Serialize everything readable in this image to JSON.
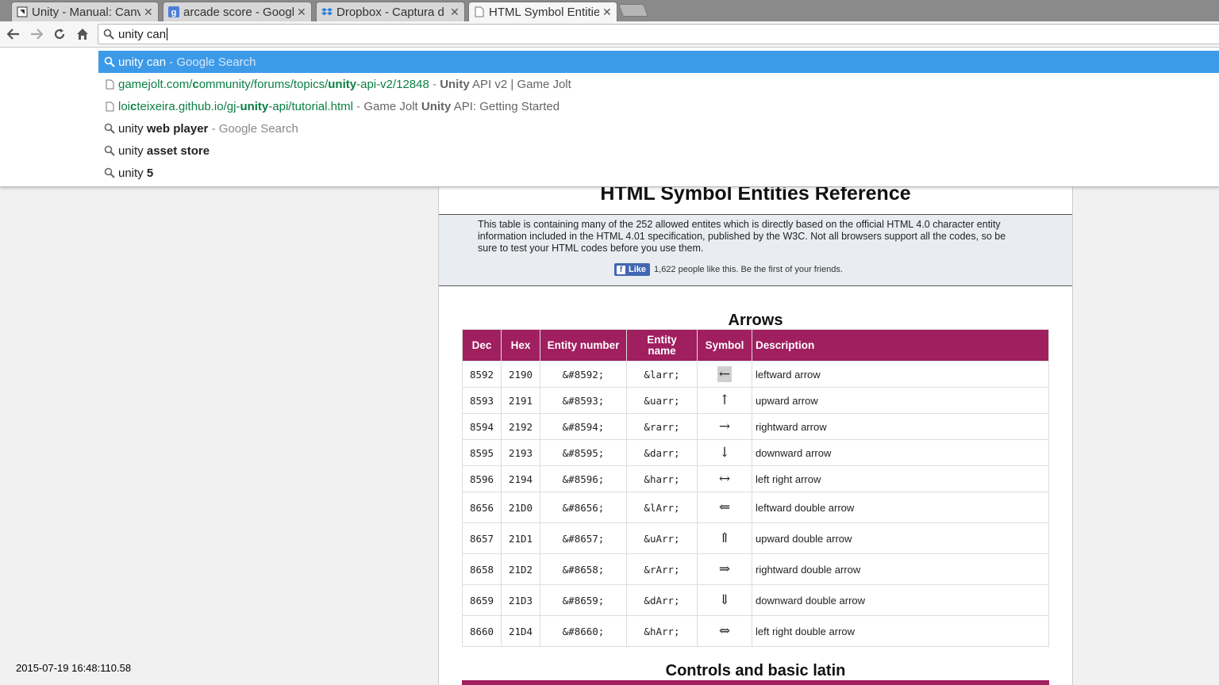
{
  "tabs": [
    {
      "title": "Unity - Manual: Canv",
      "icon": "unity-icon"
    },
    {
      "title": "arcade score - Googl",
      "icon": "google-icon"
    },
    {
      "title": "Dropbox - Captura d",
      "icon": "dropbox-icon"
    },
    {
      "title": "HTML Symbol Entitie",
      "icon": "document-icon",
      "active": true
    }
  ],
  "omnibox": {
    "value": "unity can"
  },
  "suggestions": [
    {
      "type": "search",
      "main": "unity can",
      "suffix": " - Google Search",
      "selected": true
    },
    {
      "type": "history",
      "url_pre": "gamejolt.com/",
      "url_b1": "c",
      "url_mid": "ommunity/forums/topics/",
      "url_b2": "unity",
      "url_post": "-api-v2/12848",
      "dash": " - ",
      "title_b": "Unity",
      "title_rest": " API v2 | Game Jolt"
    },
    {
      "type": "history",
      "url_pre": "loi",
      "url_b1": "c",
      "url_mid": "teixeira.github.io/gj-",
      "url_b2": "unity",
      "url_post": "-api/tutorial.html",
      "dash": " - ",
      "title_pre": "Game Jolt ",
      "title_b": "Unity",
      "title_rest": " API: Getting Started"
    },
    {
      "type": "search",
      "main": "unity ",
      "bold": "web player",
      "suffix": " - Google Search"
    },
    {
      "type": "search",
      "main": "unity ",
      "bold": "asset store",
      "suffix": ""
    },
    {
      "type": "search",
      "main": "unity ",
      "bold": "5",
      "suffix": ""
    }
  ],
  "page": {
    "title": "HTML Symbol Entities Reference",
    "intro": "This table is containing many of the 252 allowed entites which is directly based on the official HTML 4.0 character entity information included in the HTML 4.01 specification, published by the W3C. Not all browsers support all the codes, so be sure to test your HTML codes before you use them.",
    "like_label": "Like",
    "like_text": "1,622 people like this. Be the first of your friends.",
    "section1": "Arrows",
    "section2": "Controls and basic latin",
    "headers": [
      "Dec",
      "Hex",
      "Entity number",
      "Entity name",
      "Symbol",
      "Description"
    ],
    "rows": [
      {
        "dec": "8592",
        "hex": "2190",
        "num": "&#8592;",
        "name": "&larr;",
        "sym": "←",
        "desc": "leftward arrow"
      },
      {
        "dec": "8593",
        "hex": "2191",
        "num": "&#8593;",
        "name": "&uarr;",
        "sym": "↑",
        "desc": "upward arrow"
      },
      {
        "dec": "8594",
        "hex": "2192",
        "num": "&#8594;",
        "name": "&rarr;",
        "sym": "→",
        "desc": "rightward arrow"
      },
      {
        "dec": "8595",
        "hex": "2193",
        "num": "&#8595;",
        "name": "&darr;",
        "sym": "↓",
        "desc": "downward arrow"
      },
      {
        "dec": "8596",
        "hex": "2194",
        "num": "&#8596;",
        "name": "&harr;",
        "sym": "↔",
        "desc": "left right arrow"
      },
      {
        "dec": "8656",
        "hex": "21D0",
        "num": "&#8656;",
        "name": "&lArr;",
        "sym": "⇐",
        "desc": "leftward double arrow"
      },
      {
        "dec": "8657",
        "hex": "21D1",
        "num": "&#8657;",
        "name": "&uArr;",
        "sym": "⇑",
        "desc": "upward double arrow"
      },
      {
        "dec": "8658",
        "hex": "21D2",
        "num": "&#8658;",
        "name": "&rArr;",
        "sym": "⇒",
        "desc": "rightward double arrow"
      },
      {
        "dec": "8659",
        "hex": "21D3",
        "num": "&#8659;",
        "name": "&dArr;",
        "sym": "⇓",
        "desc": "downward double arrow"
      },
      {
        "dec": "8660",
        "hex": "21D4",
        "num": "&#8660;",
        "name": "&hArr;",
        "sym": "⇔",
        "desc": "left right double arrow"
      }
    ]
  },
  "timestamp": "2015-07-19 16:48:110.58",
  "colors": {
    "table_header": "#a01f5f",
    "selected_suggestion": "#3d9ae8",
    "url_green": "#0b8043"
  }
}
